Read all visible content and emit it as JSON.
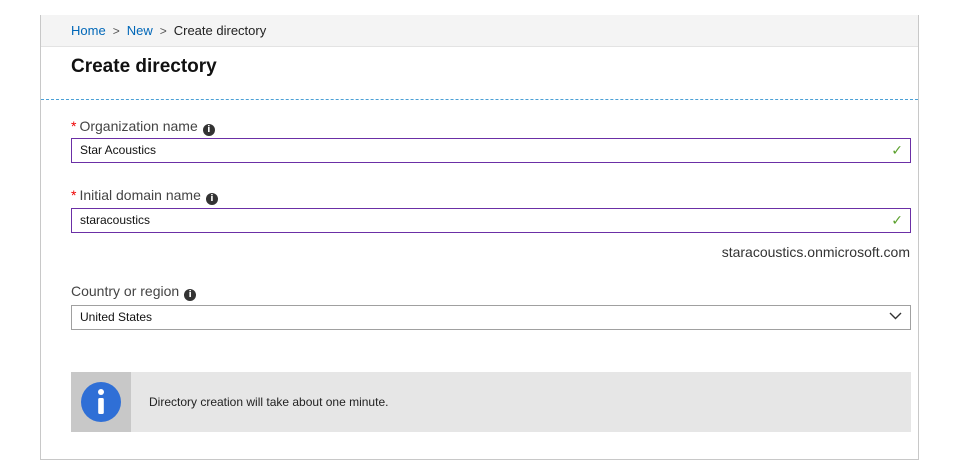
{
  "breadcrumb": {
    "items": [
      "Home",
      "New"
    ],
    "separator": ">",
    "current": "Create directory"
  },
  "page": {
    "title": "Create directory"
  },
  "form": {
    "required_marker": "*",
    "organization": {
      "label": "Organization name",
      "value": "Star Acoustics",
      "valid": true
    },
    "domain": {
      "label": "Initial domain name",
      "value": "staracoustics",
      "valid": true,
      "suffix_hint": "staracoustics.onmicrosoft.com"
    },
    "country": {
      "label": "Country or region",
      "selected": "United States"
    }
  },
  "notice": {
    "text": "Directory creation will take about one minute."
  },
  "icons": {
    "info": "info-icon",
    "check": "check-icon",
    "chevron": "chevron-down-icon"
  },
  "colors": {
    "link": "#0067b8",
    "valid_border": "#6b2fa6",
    "check": "#5aa02c",
    "required": "#e00000",
    "divider": "#4aa0d6",
    "info_icon_bg": "#2f6fd6"
  }
}
